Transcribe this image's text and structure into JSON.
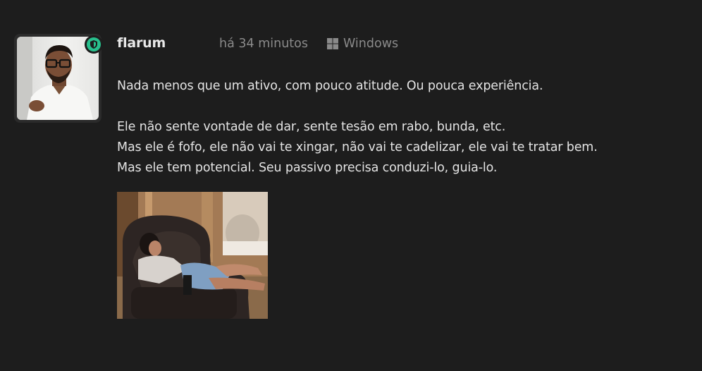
{
  "post": {
    "username": "flarum",
    "time": "há 34 minutos",
    "os": "Windows",
    "badge_icon": "shield-icon",
    "badge_color": "#28c08d",
    "paragraphs": [
      [
        "Nada menos que um ativo, com pouco atitude. Ou pouca experiência."
      ],
      [
        "Ele não sente vontade de dar, sente tesão em rabo, bunda, etc.",
        "Mas ele é fofo, ele não vai te xingar, não vai te cadelizar, ele vai te tratar bem.",
        "Mas ele tem potencial. Seu passivo precisa conduzi-lo, guia-lo."
      ]
    ],
    "gif_description": "animated-gif"
  }
}
